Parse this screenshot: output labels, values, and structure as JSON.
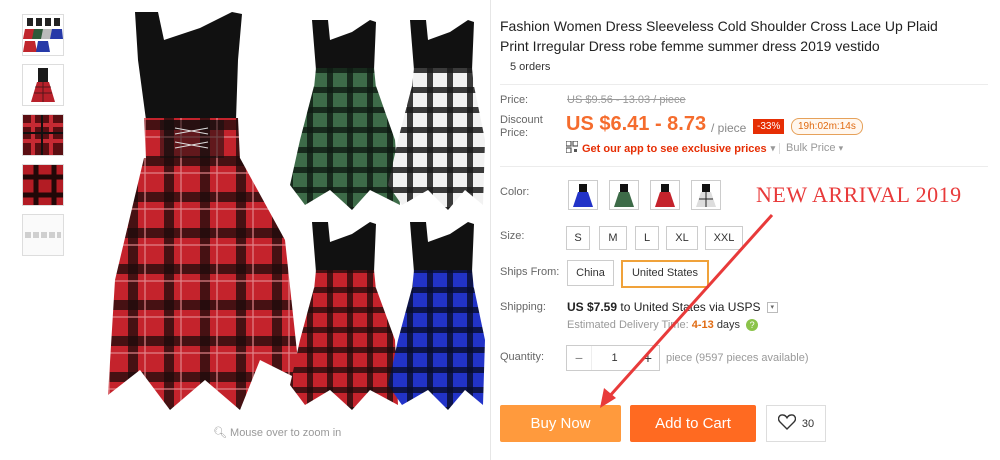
{
  "gallery": {
    "zoom_hint": "Mouse over to zoom in"
  },
  "product": {
    "title": "Fashion Women Dress Sleeveless Cold Shoulder Cross Lace Up Plaid Print Irregular Dress robe femme summer dress 2019 vestido",
    "orders": "5 orders"
  },
  "pricing": {
    "price_label": "Price:",
    "original_price": "US $9.56 - 13.03 / piece",
    "discount_label": "Discount Price:",
    "discount_price": "US $6.41 - 8.73",
    "per_unit": "/ piece",
    "discount_pct": "-33%",
    "countdown": "19h:02m:14s",
    "app_promo": "Get our app to see exclusive prices",
    "bulk_price": "Bulk Price"
  },
  "options": {
    "color_label": "Color:",
    "colors": [
      "blue",
      "green",
      "red",
      "white"
    ],
    "size_label": "Size:",
    "sizes": [
      "S",
      "M",
      "L",
      "XL",
      "XXL"
    ],
    "ships_from_label": "Ships From:",
    "ships_from": [
      "China",
      "United States"
    ],
    "ships_from_selected": "United States"
  },
  "shipping": {
    "label": "Shipping:",
    "cost": "US $7.59",
    "via": "to United States via USPS",
    "est_prefix": "Estimated Delivery Time:",
    "est_days": "4-13",
    "est_suffix": "days"
  },
  "quantity": {
    "label": "Quantity:",
    "value": "1",
    "note": "piece (9597 pieces available)"
  },
  "actions": {
    "buy_now": "Buy Now",
    "add_to_cart": "Add to Cart",
    "wishlist_count": "30"
  },
  "annotation": {
    "text": "NEW ARRIVAL 2019",
    "color": "#e83a3a"
  },
  "colors": {
    "accent": "#ff6a21",
    "price": "#f56c2d",
    "buy": "#ff9a3d"
  }
}
